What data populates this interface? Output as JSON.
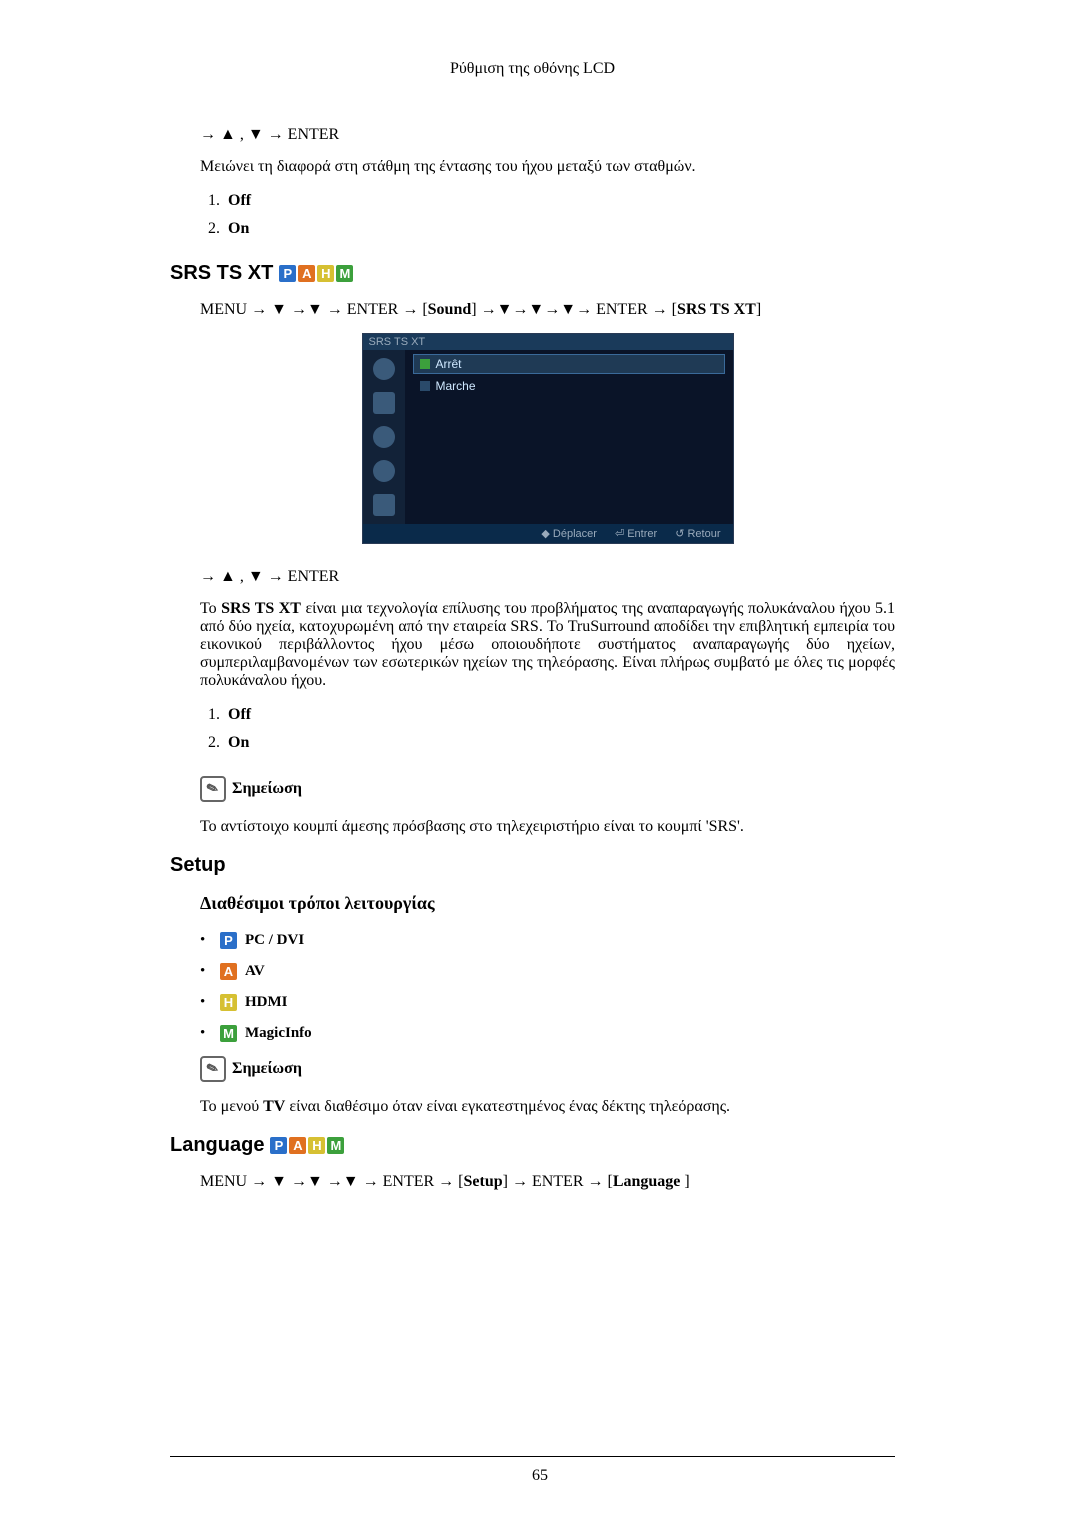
{
  "header": "Ρύθμιση της οθόνης LCD",
  "nav1": "→ ▲ , ▼ → ENTER",
  "para1": "Μειώνει τη διαφορά στη στάθμη της έντασης του ήχου μεταξύ των σταθμών.",
  "list1": {
    "item1": "Off",
    "item2": "On"
  },
  "srs": {
    "title": "SRS TS XT",
    "menu_path_pre": "MENU → ▼ →▼ → ENTER → [",
    "menu_path_sound": "Sound",
    "menu_path_mid": "] →▼→▼→▼→ ENTER → [",
    "menu_path_srs": "SRS TS XT",
    "menu_path_post": "]",
    "osd": {
      "title": "SRS TS XT",
      "opt1": "Arrêt",
      "opt2": "Marche",
      "foot1": "Déplacer",
      "foot2": "Entrer",
      "foot3": "Retour"
    },
    "nav2": "→ ▲ , ▼ → ENTER",
    "desc_pre": "Το ",
    "desc_bold": "SRS TS XT",
    "desc_post": " είναι μια τεχνολογία επίλυσης του προβλήματος της αναπαραγωγής πολυκάναλου ήχου 5.1 από δύο ηχεία, κατοχυρωμένη από την εταιρεία SRS. Το TruSurround αποδίδει την επιβλητική εμπειρία του εικονικού περιβάλλοντος ήχου μέσω οποιουδήποτε συστήματος αναπαραγωγής δύο ηχείων, συμπεριλαμβανομένων των εσωτερικών ηχείων της τηλεόρασης. Είναι πλήρως συμβατό με όλες τις μορφές πολυκάναλου ήχου.",
    "list2": {
      "item1": "Off",
      "item2": "On"
    },
    "note_label": "Σημείωση",
    "note_text": "Το αντίστοιχο κουμπί άμεσης πρόσβασης στο τηλεχειριστήριο είναι το κουμπί 'SRS'."
  },
  "setup": {
    "title": "Setup",
    "modes_title": "Διαθέσιμοι τρόποι λειτουργίας",
    "modes": {
      "pc": "PC / DVI",
      "av": "AV",
      "hdmi": "HDMI",
      "magic": "MagicInfo"
    },
    "note_label": "Σημείωση",
    "note_pre": "Το μενού ",
    "note_bold": "TV",
    "note_post": " είναι διαθέσιμο όταν είναι εγκατεστημένος ένας δέκτης τηλεόρασης."
  },
  "language": {
    "title": "Language",
    "path_pre": "MENU → ▼ →▼ →▼ → ENTER → [",
    "path_setup": "Setup",
    "path_mid": "] → ENTER → [",
    "path_lang": "Language",
    "path_post": " ]"
  },
  "page_number": "65"
}
